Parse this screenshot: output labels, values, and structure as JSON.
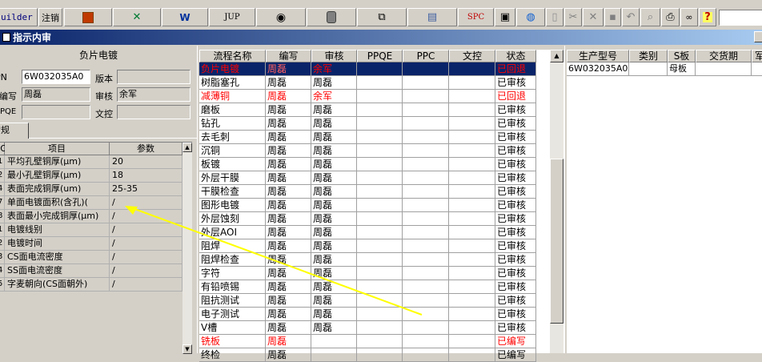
{
  "toolbar": {
    "builder_label": "uilder",
    "logout_label": "注销",
    "jup_label": "JUP",
    "spc_label": "SPC",
    "icons": [
      "powerpoint-icon",
      "excel-icon",
      "word-icon",
      "jup-icon",
      "eye-icon",
      "database-icon",
      "network-icon",
      "printer-device-icon",
      "spc-icon",
      "form-icon",
      "globe-icon",
      "new-doc-icon",
      "cut-icon",
      "delete-icon",
      "save-icon",
      "undo-icon",
      "preview-icon",
      "print-icon",
      "binoculars-icon",
      "help-icon"
    ]
  },
  "window": {
    "title": "指示内审"
  },
  "left": {
    "board_name": "负片电镀",
    "pn_label": "PN",
    "pn_value": "6W032035A0",
    "version_label": "版本",
    "version_value": "",
    "writer_label": "编写",
    "writer_value": "周磊",
    "reviewer_label": "审核",
    "reviewer_value": "余军",
    "ppqe_label": "PPQE",
    "ppqe_value": "",
    "doc_control_label": "文控",
    "doc_control_value": "",
    "tab_label": "常规",
    "param_headers": {
      "no": "NO",
      "item": "项目",
      "param": "参数"
    },
    "params": [
      {
        "no": "1",
        "item": "平均孔壁铜厚(μm)",
        "value": "20"
      },
      {
        "no": "2",
        "item": "最小孔壁铜厚(μm)",
        "value": "18"
      },
      {
        "no": "4",
        "item": "表面完成铜厚(um)",
        "value": "25-35"
      },
      {
        "no": "7",
        "item": "单面电镀面积(含孔)(",
        "value": "/"
      },
      {
        "no": "8",
        "item": "表面最小完成铜厚(μm)",
        "value": "/"
      },
      {
        "no": "1",
        "item": "电镀线别",
        "value": "/"
      },
      {
        "no": "2",
        "item": "电镀时间",
        "value": "/"
      },
      {
        "no": "3",
        "item": "CS面电流密度",
        "value": "/"
      },
      {
        "no": "4",
        "item": "SS面电流密度",
        "value": "/"
      },
      {
        "no": "5",
        "item": "字麦朝向(CS面朝外)",
        "value": "/"
      }
    ]
  },
  "middle": {
    "headers": [
      "流程名称",
      "编写",
      "审核",
      "PPQE",
      "PPC",
      "文控",
      "状态"
    ],
    "rows": [
      {
        "name": "负片电镀",
        "writer": "周磊",
        "reviewer": "余军",
        "ppqe": "",
        "ppc": "",
        "doc": "",
        "status": "已回退",
        "red": true,
        "selected": true
      },
      {
        "name": "树脂塞孔",
        "writer": "周磊",
        "reviewer": "周磊",
        "ppqe": "",
        "ppc": "",
        "doc": "",
        "status": "已审核",
        "red": false
      },
      {
        "name": "减薄铜",
        "writer": "周磊",
        "reviewer": "余军",
        "ppqe": "",
        "ppc": "",
        "doc": "",
        "status": "已回退",
        "red": true
      },
      {
        "name": "磨板",
        "writer": "周磊",
        "reviewer": "周磊",
        "ppqe": "",
        "ppc": "",
        "doc": "",
        "status": "已审核",
        "red": false
      },
      {
        "name": "钻孔",
        "writer": "周磊",
        "reviewer": "周磊",
        "ppqe": "",
        "ppc": "",
        "doc": "",
        "status": "已审核",
        "red": false
      },
      {
        "name": "去毛刺",
        "writer": "周磊",
        "reviewer": "周磊",
        "ppqe": "",
        "ppc": "",
        "doc": "",
        "status": "已审核",
        "red": false
      },
      {
        "name": "沉铜",
        "writer": "周磊",
        "reviewer": "周磊",
        "ppqe": "",
        "ppc": "",
        "doc": "",
        "status": "已审核",
        "red": false
      },
      {
        "name": "板镀",
        "writer": "周磊",
        "reviewer": "周磊",
        "ppqe": "",
        "ppc": "",
        "doc": "",
        "status": "已审核",
        "red": false
      },
      {
        "name": "外层干膜",
        "writer": "周磊",
        "reviewer": "周磊",
        "ppqe": "",
        "ppc": "",
        "doc": "",
        "status": "已审核",
        "red": false
      },
      {
        "name": "干膜检查",
        "writer": "周磊",
        "reviewer": "周磊",
        "ppqe": "",
        "ppc": "",
        "doc": "",
        "status": "已审核",
        "red": false
      },
      {
        "name": "图形电镀",
        "writer": "周磊",
        "reviewer": "周磊",
        "ppqe": "",
        "ppc": "",
        "doc": "",
        "status": "已审核",
        "red": false
      },
      {
        "name": "外层蚀刻",
        "writer": "周磊",
        "reviewer": "周磊",
        "ppqe": "",
        "ppc": "",
        "doc": "",
        "status": "已审核",
        "red": false
      },
      {
        "name": "外层AOI",
        "writer": "周磊",
        "reviewer": "周磊",
        "ppqe": "",
        "ppc": "",
        "doc": "",
        "status": "已审核",
        "red": false
      },
      {
        "name": "阻焊",
        "writer": "周磊",
        "reviewer": "周磊",
        "ppqe": "",
        "ppc": "",
        "doc": "",
        "status": "已审核",
        "red": false
      },
      {
        "name": "阻焊检查",
        "writer": "周磊",
        "reviewer": "周磊",
        "ppqe": "",
        "ppc": "",
        "doc": "",
        "status": "已审核",
        "red": false
      },
      {
        "name": "字符",
        "writer": "周磊",
        "reviewer": "周磊",
        "ppqe": "",
        "ppc": "",
        "doc": "",
        "status": "已审核",
        "red": false
      },
      {
        "name": "有铅喷锡",
        "writer": "周磊",
        "reviewer": "周磊",
        "ppqe": "",
        "ppc": "",
        "doc": "",
        "status": "已审核",
        "red": false
      },
      {
        "name": "阻抗测试",
        "writer": "周磊",
        "reviewer": "周磊",
        "ppqe": "",
        "ppc": "",
        "doc": "",
        "status": "已审核",
        "red": false
      },
      {
        "name": "电子测试",
        "writer": "周磊",
        "reviewer": "周磊",
        "ppqe": "",
        "ppc": "",
        "doc": "",
        "status": "已审核",
        "red": false
      },
      {
        "name": "V槽",
        "writer": "周磊",
        "reviewer": "周磊",
        "ppqe": "",
        "ppc": "",
        "doc": "",
        "status": "已审核",
        "red": false
      },
      {
        "name": "铣板",
        "writer": "周磊",
        "reviewer": "",
        "ppqe": "",
        "ppc": "",
        "doc": "",
        "status": "已编写",
        "red": true
      },
      {
        "name": "终检",
        "writer": "周磊",
        "reviewer": "",
        "ppqe": "",
        "ppc": "",
        "doc": "",
        "status": "已编写",
        "red": false
      }
    ]
  },
  "right": {
    "headers": [
      "生产型号",
      "类别",
      "S板",
      "交货期",
      "军"
    ],
    "rows": [
      {
        "model": "6W032035A0",
        "category": "",
        "s_board": "母板",
        "delivery": "",
        "extra": ""
      }
    ]
  },
  "colors": {
    "accent_red": "#ff0000",
    "selection": "#0a246a",
    "arrow": "#ffff00"
  }
}
